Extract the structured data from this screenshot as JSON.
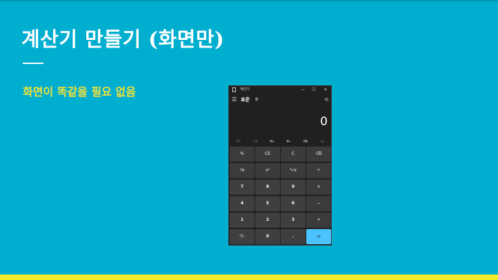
{
  "slide": {
    "title": "계산기 만들기 (화면만)",
    "bullet": "화면이 똑같을 필요 없음",
    "colors": {
      "background": "#00aed0",
      "title": "#ffffff",
      "bullet": "#f3e23a",
      "bottom_bar": "#f3ec2a"
    }
  },
  "calculator": {
    "window_title": "계산기",
    "window_controls": {
      "minimize": "−",
      "maximize": "☐",
      "close": "✕"
    },
    "menu_icon": "☰",
    "mode": "표준",
    "keep_on_top_icon": "⧉",
    "history_icon": "⟲",
    "display_value": "0",
    "memory_keys": [
      "MC",
      "MR",
      "M+",
      "M−",
      "MS",
      "M▾"
    ],
    "keys": [
      [
        "%",
        "CE",
        "C",
        "⌫"
      ],
      [
        "⅟x",
        "x²",
        "²√x",
        "÷"
      ],
      [
        "7",
        "8",
        "9",
        "×"
      ],
      [
        "4",
        "5",
        "6",
        "−"
      ],
      [
        "1",
        "2",
        "3",
        "+"
      ],
      [
        "⁺∕₋",
        "0",
        ".",
        "="
      ]
    ],
    "colors": {
      "window": "#202020",
      "key": "#3b3b3b",
      "equals": "#4cc2ff"
    }
  }
}
